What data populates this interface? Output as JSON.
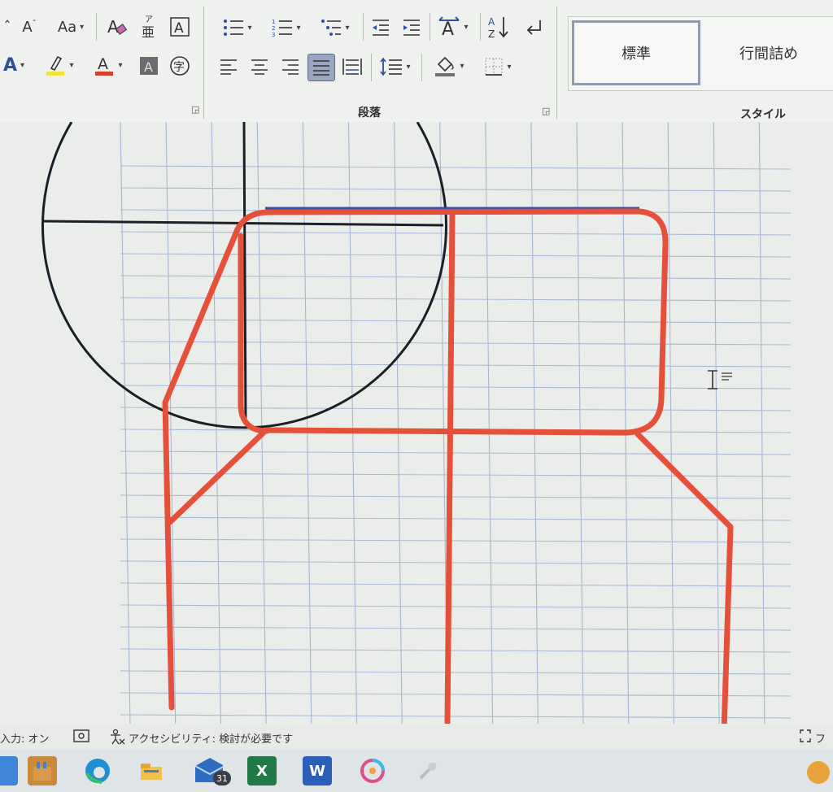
{
  "ribbon": {
    "font_row1": [
      {
        "name": "grow-font",
        "glyph": "Aˇ"
      },
      {
        "name": "change-case",
        "glyph": "Aa"
      },
      {
        "name": "clear-format",
        "glyph": "A⊘"
      },
      {
        "name": "phonetic-guide",
        "glyph": "ア\n亜"
      },
      {
        "name": "char-border",
        "glyph": "A"
      }
    ],
    "font_row2": [
      {
        "name": "text-effects",
        "glyph": "A"
      },
      {
        "name": "highlight",
        "glyph": "✎"
      },
      {
        "name": "font-color",
        "glyph": "A"
      },
      {
        "name": "char-shading",
        "glyph": "A"
      },
      {
        "name": "enclose-char",
        "glyph": "字"
      }
    ],
    "paragraph_group_label": "段落",
    "styles_group_label": "スタイル",
    "styles": [
      {
        "label": "標準",
        "selected": true
      },
      {
        "label": "行間詰め",
        "selected": false
      }
    ],
    "colors": {
      "highlight": "#f2e23a",
      "font_color": "#d8402e",
      "selected_btn": "#9aa6bf"
    }
  },
  "status": {
    "input_mode": "入力: オン",
    "accessibility": "アクセシビリティ: 検討が必要です",
    "focus": "フォ"
  },
  "taskbar": {
    "mail_badge": "31",
    "apps": [
      "file-explorer",
      "store",
      "edge",
      "explorer",
      "mail",
      "excel",
      "word",
      "photos",
      "weather"
    ]
  },
  "drawing": {
    "grid_color": "#a9b7d4",
    "line_color": "#e4503a",
    "black_line": "#1d1f28"
  }
}
